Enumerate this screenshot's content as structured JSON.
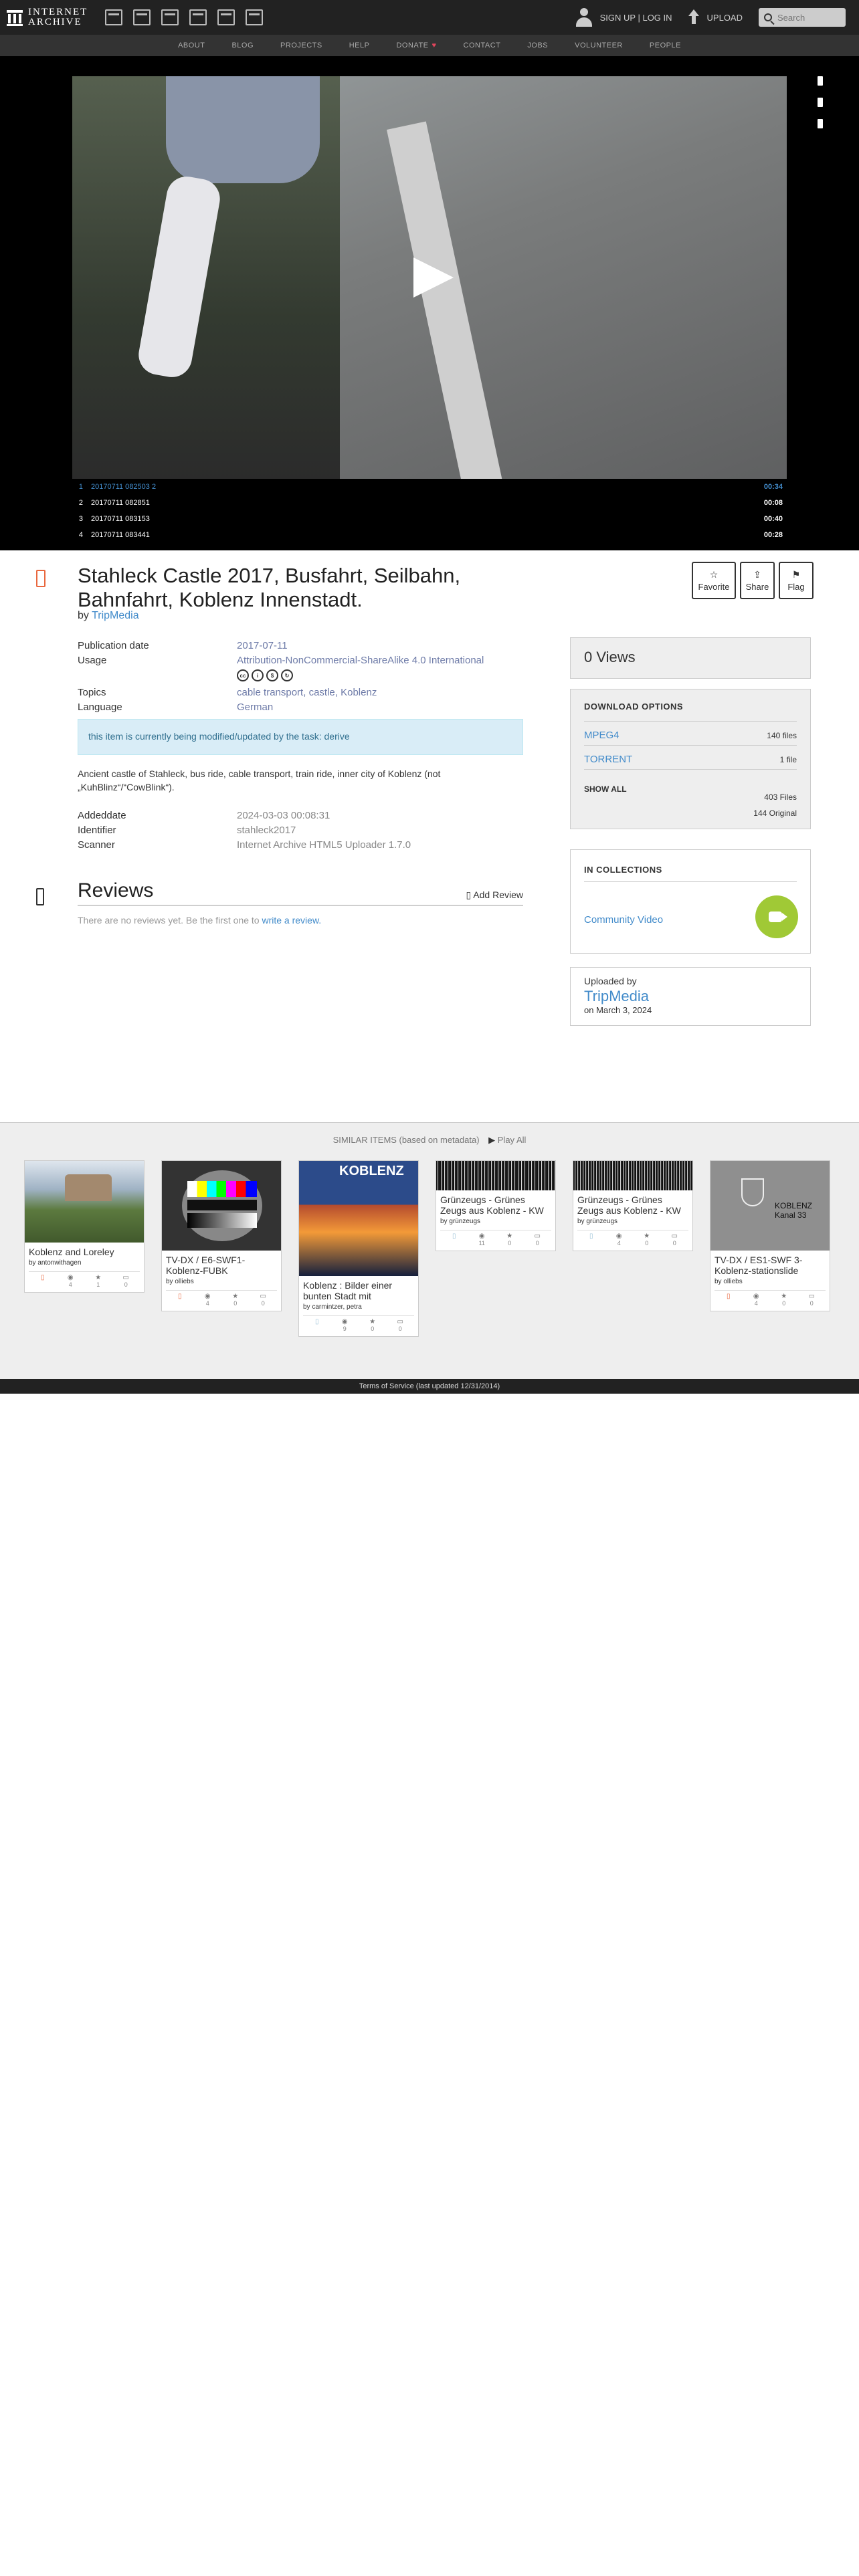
{
  "header": {
    "logo_line1": "INTERNET",
    "logo_line2": "ARCHIVE",
    "media_icons": [
      "web-icon",
      "texts-icon",
      "video-icon",
      "audio-icon",
      "software-icon",
      "images-icon"
    ],
    "signup_label": "SIGN UP | LOG IN",
    "upload_label": "UPLOAD",
    "search_placeholder": "Search"
  },
  "nav": {
    "items": [
      "ABOUT",
      "BLOG",
      "PROJECTS",
      "HELP",
      "DONATE",
      "CONTACT",
      "JOBS",
      "VOLUNTEER",
      "PEOPLE"
    ],
    "donate_heart": "♥"
  },
  "playlist": [
    {
      "num": "1",
      "name": "20170711 082503 2",
      "duration": "00:34",
      "active": true
    },
    {
      "num": "2",
      "name": "20170711 082851",
      "duration": "00:08",
      "active": false
    },
    {
      "num": "3",
      "name": "20170711 083153",
      "duration": "00:40",
      "active": false
    },
    {
      "num": "4",
      "name": "20170711 083441",
      "duration": "00:28",
      "active": false
    }
  ],
  "item": {
    "title": "Stahleck Castle 2017, Busfahrt, Seilbahn, Bahnfahrt, Koblenz Innenstadt.",
    "by_label": "by",
    "creator": "TripMedia",
    "actions": {
      "favorite": "Favorite",
      "share": "Share",
      "flag": "Flag"
    },
    "metadata": {
      "publication_date_label": "Publication date",
      "publication_date": "2017-07-11",
      "usage_label": "Usage",
      "usage": "Attribution-NonCommercial-ShareAlike 4.0 International",
      "topics_label": "Topics",
      "topics": [
        "cable transport",
        "castle",
        "Koblenz"
      ],
      "language_label": "Language",
      "language": "German"
    },
    "notice": "this item is currently being modified/updated by the task: derive",
    "description": "Ancient castle of Stahleck, bus ride, cable transport, train ride, inner city of Koblenz (not „KuhBlinz“/“CowBlink“).",
    "metadata2": {
      "addeddate_label": "Addeddate",
      "addeddate": "2024-03-03 00:08:31",
      "identifier_label": "Identifier",
      "identifier": "stahleck2017",
      "scanner_label": "Scanner",
      "scanner": "Internet Archive HTML5 Uploader 1.7.0"
    }
  },
  "reviews": {
    "heading": "Reviews",
    "add_label": "Add Review",
    "empty_text": "There are no reviews yet. Be the first one to",
    "write_link": "write a review."
  },
  "sidebar": {
    "views": "0 Views",
    "download_heading": "DOWNLOAD OPTIONS",
    "downloads": [
      {
        "format": "MPEG4",
        "count": "140 files"
      },
      {
        "format": "TORRENT",
        "count": "1 file"
      }
    ],
    "show_all": "SHOW ALL",
    "all_files": "403 Files",
    "original": "144 Original",
    "collections_heading": "IN COLLECTIONS",
    "collection": "Community Video",
    "uploaded_by_label": "Uploaded by",
    "uploader": "TripMedia",
    "upload_date": "on March 3, 2024"
  },
  "similar": {
    "heading": "SIMILAR ITEMS (based on metadata)",
    "play_all": "Play All",
    "items": [
      {
        "title": "Koblenz and Loreley",
        "by": "by antonwithagen",
        "stats": [
          "",
          "4",
          "1",
          "0"
        ],
        "type": "video"
      },
      {
        "title": "TV-DX / E6-SWF1-Koblenz-FUBK",
        "by": "by olliebs",
        "stats": [
          "",
          "4",
          "0",
          "0"
        ],
        "type": "video"
      },
      {
        "title": "Koblenz : Bilder einer bunten Stadt mit",
        "by": "by carmintzer, petra",
        "stats": [
          "",
          "9",
          "0",
          "0"
        ],
        "type": "texts"
      },
      {
        "title": "Grünzeugs - Grünes Zeugs aus Koblenz - KW",
        "by": "by grünzeugs",
        "stats": [
          "",
          "11",
          "0",
          "0"
        ],
        "type": "texts"
      },
      {
        "title": "Grünzeugs - Grünes Zeugs aus Koblenz - KW",
        "by": "by grünzeugs",
        "stats": [
          "",
          "4",
          "0",
          "0"
        ],
        "type": "texts"
      },
      {
        "title": "TV-DX / ES1-SWF 3-Koblenz-stationslide",
        "by": "by olliebs",
        "stats": [
          "",
          "4",
          "0",
          "0"
        ],
        "type": "video"
      }
    ],
    "thumb_texts": {
      "koblenz_big": "KOBLENZ",
      "koblenz_small": "KOBLENZ",
      "kanal": "Kanal 33"
    }
  },
  "footer": {
    "text": "Terms of Service (last updated 12/31/2014)"
  },
  "colors": {
    "accent": "#428bca",
    "topbar": "#222222",
    "collection_badge": "#a0c936",
    "item_icon": "#e9683f",
    "notice_bg": "#d9edf7"
  }
}
